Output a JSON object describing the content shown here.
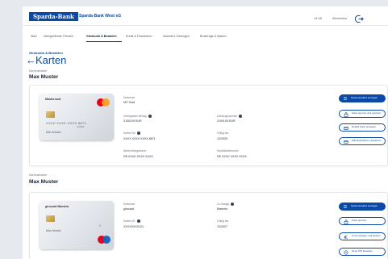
{
  "header": {
    "logo": "Sparda-Bank",
    "bank_name": "Sparda-Bank West eG",
    "time": "14:46",
    "logout_label": "Abmelden"
  },
  "nav": {
    "items": [
      {
        "label": "Start"
      },
      {
        "label": "Übergreifende Themen"
      },
      {
        "label": "Girokonto & Bezahlen"
      },
      {
        "label": "Kredit & Finanzieren"
      },
      {
        "label": "Zukunft & Vorsorgen"
      },
      {
        "label": "Brokerage & Sparen"
      }
    ],
    "active_index": 2
  },
  "breadcrumb": "Girokonto & Bezahlen",
  "page_title": "Karten",
  "cards": [
    {
      "holder_label": "Karteninhaber",
      "holder_name": "Max Muster",
      "card_visual": {
        "brand": "Mastercard",
        "number": "XXXX XXXX XXXX 8671",
        "valid": "12/2029",
        "name": "Max Muster"
      },
      "fields": {
        "kartenart_label": "Kartenart",
        "kartenart_value": "MC Gold",
        "limit_label": "Verfügbarer Betrag",
        "limit_value": "3.000,00 EUR",
        "zahlungsrahmen_label": "Zahlungsrahmen",
        "zahlungsrahmen_value": "3.000,00 EUR",
        "kartennr_label": "Karten-Nr.",
        "kartennr_value": "XXXX XXXX XXXX 8671",
        "gueltig_label": "Gültig bis",
        "gueltig_value": "12/2029",
        "abrechnung_label": "Abrechnungskonto",
        "abrechnung_value": "DE XXXX XXXX XXXX",
        "kreditkartenkonto_label": "Kreditkartenkonto",
        "kreditkartenkonto_value": "DE XXXX XXXX XXXX"
      },
      "actions": [
        {
          "label": "Kartenumsätze anzeigen",
          "style": "primary",
          "icon": "list-icon"
        },
        {
          "label": "Karte sperren und ersetzen",
          "style": "outline",
          "icon": "lock-icon"
        },
        {
          "label": "Details Karte anzeigen",
          "style": "outline",
          "icon": "card-icon"
        },
        {
          "label": "Zahlungsrahmen anpassen",
          "style": "outline",
          "icon": "card-icon"
        }
      ]
    },
    {
      "holder_label": "Karteninhaber",
      "holder_name": "Max Muster",
      "card_visual": {
        "brand": "girocard Maestro",
        "name": "Max Muster"
      },
      "fields": {
        "kartenart_label": "Kartenart",
        "kartenart_value": "girocard",
        "type_label": "Co-Badge",
        "type_value": "Maestro",
        "kartennr_label": "Karten-ID",
        "kartennr_value": "XXXXXXXX121",
        "gueltig_label": "Gültig bis",
        "gueltig_value": "12/2027"
      },
      "actions": [
        {
          "label": "Kartenumsätze anzeigen",
          "style": "primary",
          "icon": "list-icon"
        },
        {
          "label": "Karte sperren",
          "style": "outline",
          "icon": "lock-icon"
        },
        {
          "label": "Limit anzeigen und ändern",
          "style": "outline",
          "icon": "euro-icon"
        },
        {
          "label": "Neue PIN bestellen",
          "style": "outline",
          "icon": "pin-icon"
        }
      ]
    }
  ],
  "colors": {
    "brand": "#0a4aa6",
    "background": "#e6e9ee"
  }
}
